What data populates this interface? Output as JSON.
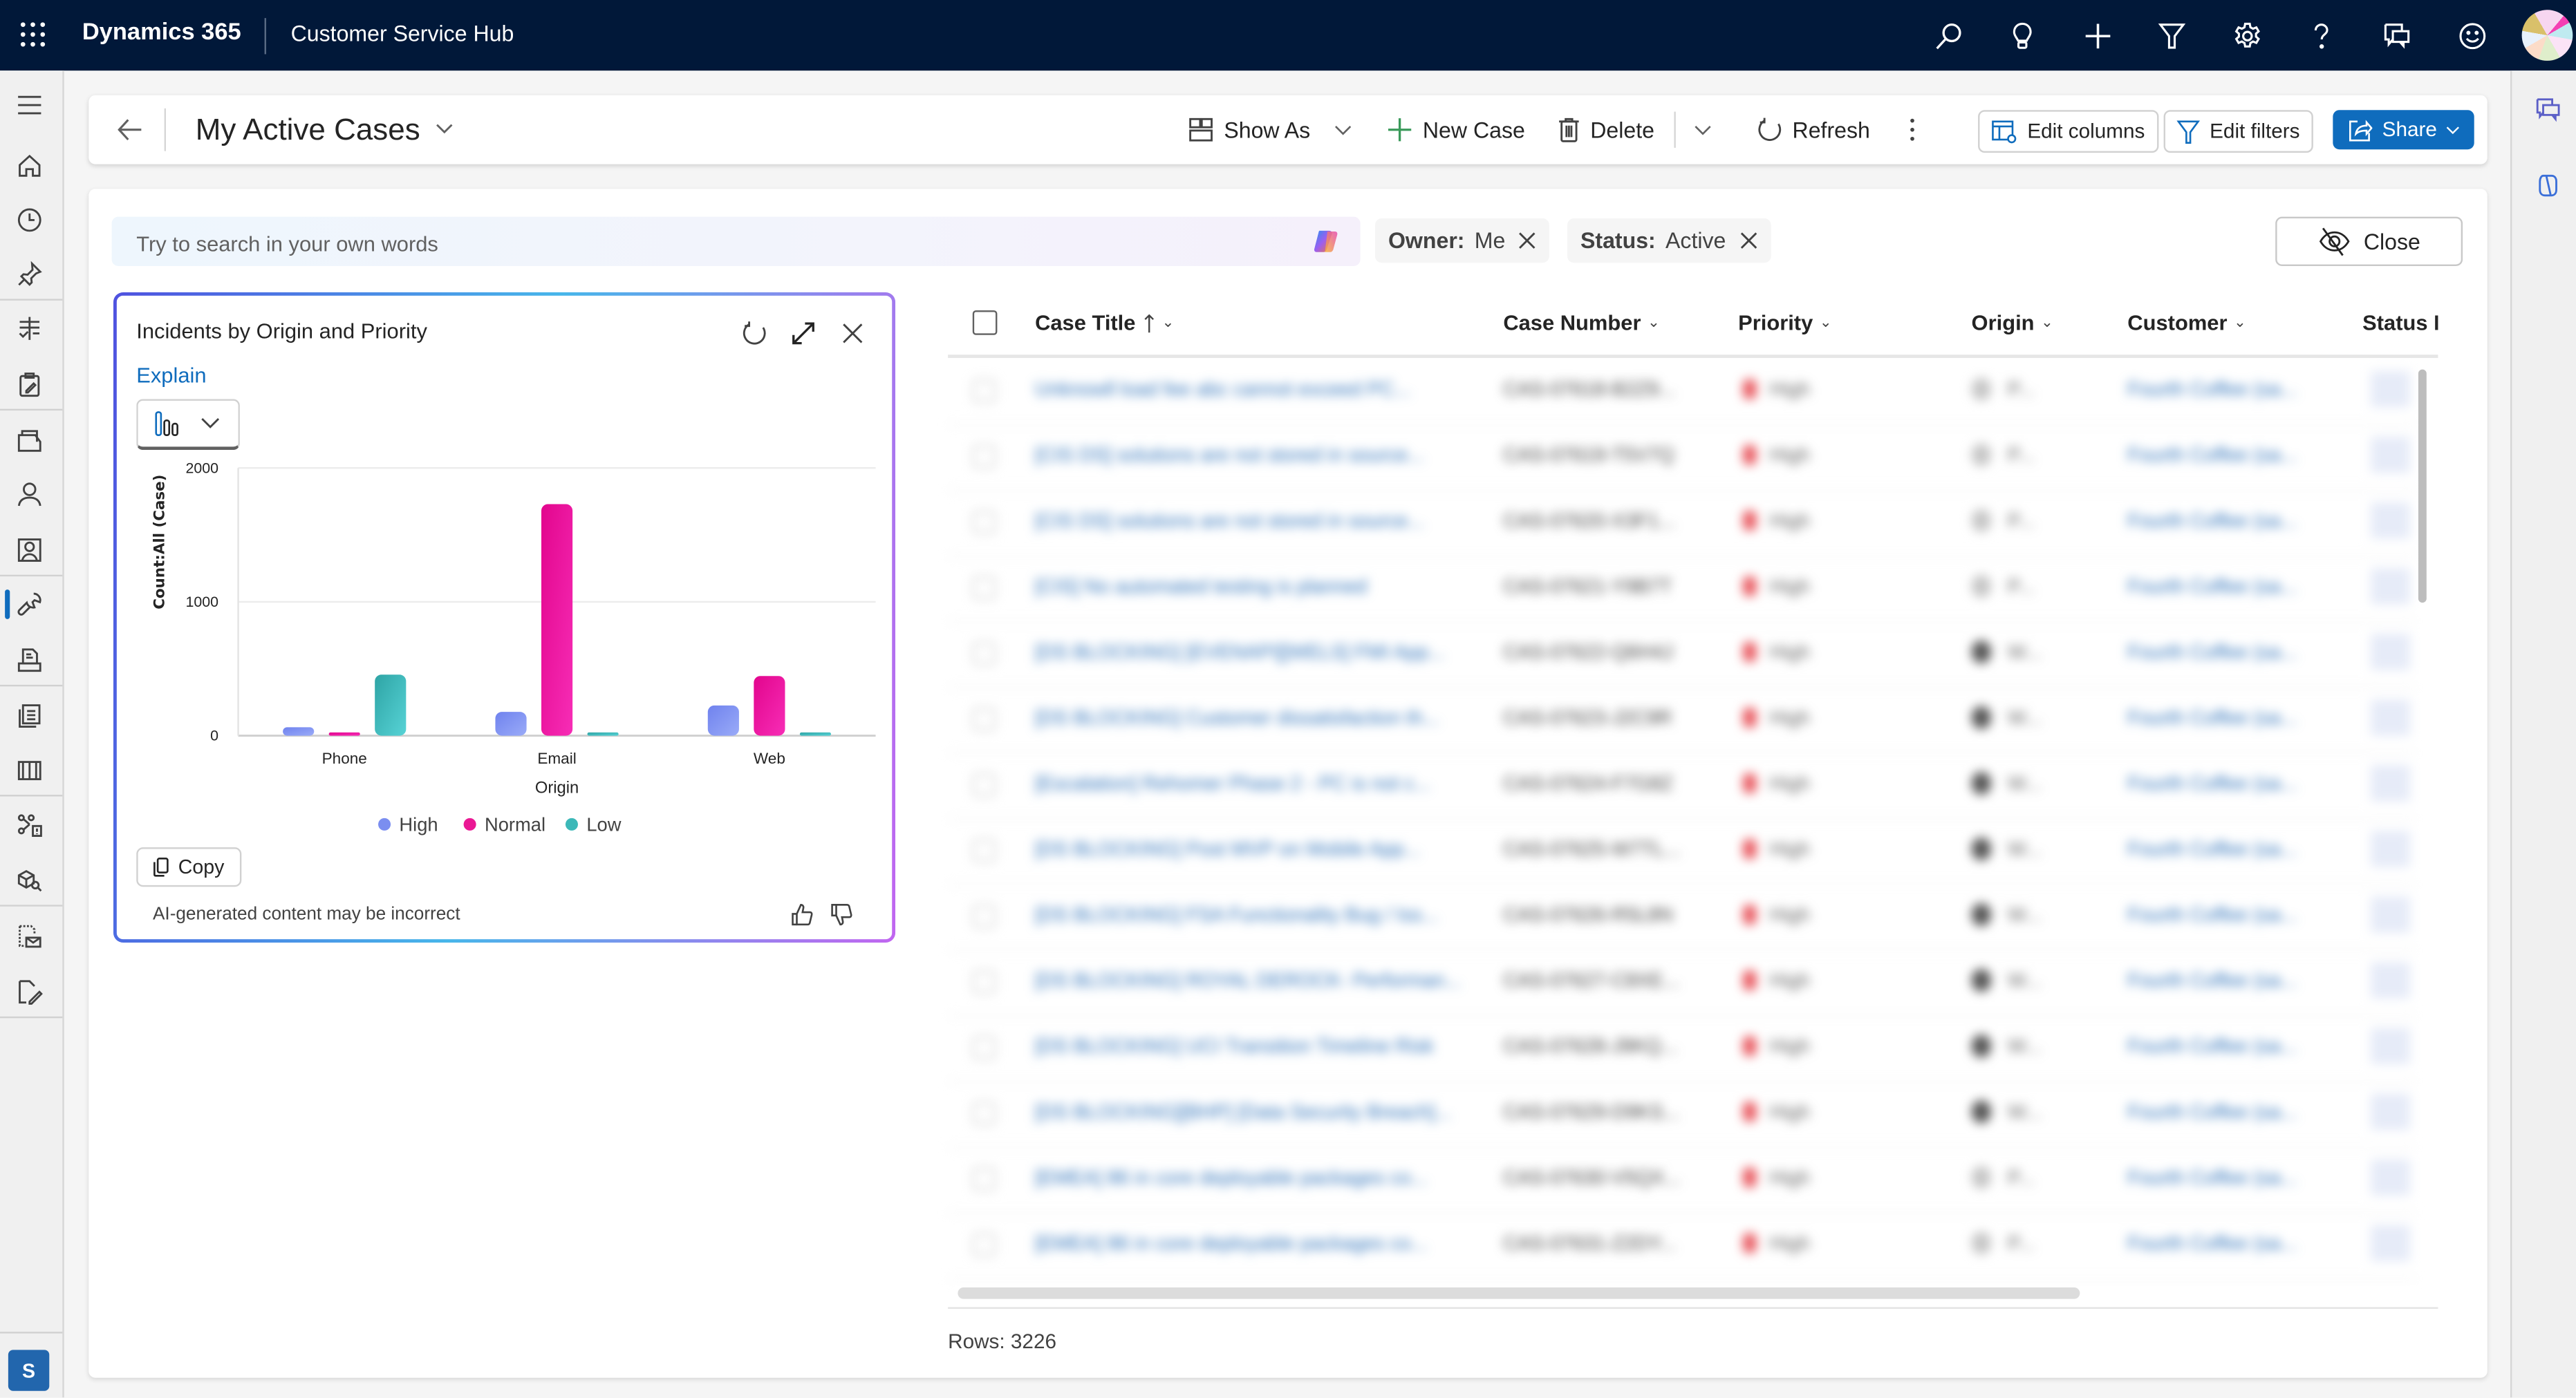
{
  "topbar": {
    "brand": "Dynamics 365",
    "app_name": "Customer Service Hub",
    "icons": [
      "search-icon",
      "lightbulb-icon",
      "plus-icon",
      "filter-icon",
      "settings-icon",
      "help-icon",
      "chat-icon",
      "feedback-smiley-icon",
      "user-avatar"
    ]
  },
  "leftnav": {
    "items": [
      {
        "name": "menu",
        "icon": "hamburger-icon"
      },
      {
        "name": "home",
        "icon": "home-icon"
      },
      {
        "name": "recent",
        "icon": "clock-icon"
      },
      {
        "name": "pinned",
        "icon": "pin-icon"
      },
      {
        "name": "dashboards",
        "icon": "dashboard-icon"
      },
      {
        "name": "activities",
        "icon": "clipboard-icon"
      },
      {
        "name": "accounts",
        "icon": "folder-icon"
      },
      {
        "name": "contacts",
        "icon": "person-icon"
      },
      {
        "name": "social-profiles",
        "icon": "contact-card-icon"
      },
      {
        "name": "cases",
        "icon": "wrench-icon",
        "active": true
      },
      {
        "name": "queues",
        "icon": "inbox-icon"
      },
      {
        "name": "knowledge-articles",
        "icon": "documents-icon"
      },
      {
        "name": "knowledge-search",
        "icon": "book-icon"
      },
      {
        "name": "entitlements",
        "icon": "network-icon"
      },
      {
        "name": "products",
        "icon": "box-key-icon"
      },
      {
        "name": "mail-templates",
        "icon": "mail-template-icon"
      },
      {
        "name": "notes",
        "icon": "page-edit-icon"
      }
    ],
    "area_switcher": "S"
  },
  "commandbar": {
    "view_title": "My Active Cases",
    "show_as": "Show As",
    "new_case": "New Case",
    "delete": "Delete",
    "refresh": "Refresh",
    "edit_columns": "Edit columns",
    "edit_filters": "Edit filters",
    "share": "Share"
  },
  "search": {
    "placeholder": "Try to search in your own words"
  },
  "filters": [
    {
      "label": "Owner:",
      "value": "Me"
    },
    {
      "label": "Status:",
      "value": "Active"
    }
  ],
  "close_button": "Close",
  "chart_card": {
    "title": "Incidents by Origin and Priority",
    "explain_link": "Explain",
    "copy_label": "Copy",
    "disclaimer": "AI-generated content may be incorrect",
    "colors": {
      "High": "#7b8ef0",
      "Normal": "#ea1894",
      "Low": "#3cb8b8"
    }
  },
  "chart_data": {
    "type": "bar",
    "title": "Incidents by Origin and Priority",
    "xlabel": "Origin",
    "ylabel": "Count:All (Case)",
    "categories": [
      "Phone",
      "Email",
      "Web"
    ],
    "series": [
      {
        "name": "High",
        "values": [
          63,
          178,
          226
        ]
      },
      {
        "name": "Normal",
        "values": [
          17,
          1730,
          446
        ]
      },
      {
        "name": "Low",
        "values": [
          456,
          17,
          17
        ]
      }
    ],
    "ylim": [
      0,
      2000
    ],
    "yticks": [
      0,
      1000,
      2000
    ],
    "grid": true,
    "legend": "bottom-center"
  },
  "grid": {
    "columns": [
      {
        "label": "Case Title",
        "sort": "ascending"
      },
      {
        "label": "Case Number"
      },
      {
        "label": "Priority"
      },
      {
        "label": "Origin"
      },
      {
        "label": "Customer"
      },
      {
        "label": "Status R"
      }
    ],
    "rows": [
      {
        "title": "Unknowll load fee abc cannot exceed PC...",
        "number": "CAS-07618-B2Z9...",
        "priority": "High",
        "origin": "P...",
        "origin_kind": "phone",
        "customer": "Fourth Coffee (sa..."
      },
      {
        "title": "[CIS DS] solutions are not stored in source...",
        "number": "CAS-07619-T5V7Q",
        "priority": "High",
        "origin": "P...",
        "origin_kind": "phone",
        "customer": "Fourth Coffee (sa..."
      },
      {
        "title": "[CIS DS] solutions are not stored in source...",
        "number": "CAS-07620-X3F1...",
        "priority": "High",
        "origin": "P...",
        "origin_kind": "phone",
        "customer": "Fourth Coffee (sa..."
      },
      {
        "title": "[CIS] No automated testing is planned",
        "number": "CAS-07621-Y9B7T",
        "priority": "High",
        "origin": "P...",
        "origin_kind": "phone",
        "customer": "Fourth Coffee (sa..."
      },
      {
        "title": "[DS BLOCKING] [EVENAPI][WELS] FMI App...",
        "number": "CAS-07622-Q6H4J",
        "priority": "High",
        "origin": "W...",
        "origin_kind": "web",
        "customer": "Fourth Coffee (sa..."
      },
      {
        "title": "[DS BLOCKING] Customer dissatisfaction th...",
        "number": "CAS-07623-J2C9R",
        "priority": "High",
        "origin": "W...",
        "origin_kind": "web",
        "customer": "Fourth Coffee (sa..."
      },
      {
        "title": "[Escalation] Rehomer Phase 2 - PC is not c...",
        "number": "CAS-07624-F7G8Z",
        "priority": "High",
        "origin": "W...",
        "origin_kind": "web",
        "customer": "Fourth Coffee (sa..."
      },
      {
        "title": "[DS BLOCKING] Post MVP on Mobile App...",
        "number": "CAS-07625-W7TL...",
        "priority": "High",
        "origin": "W...",
        "origin_kind": "web",
        "customer": "Fourth Coffee (sa..."
      },
      {
        "title": "[DS BLOCKING] FSA Functionality Bug / Iss...",
        "number": "CAS-07626-R5L8N",
        "priority": "High",
        "origin": "W...",
        "origin_kind": "web",
        "customer": "Fourth Coffee (sa..."
      },
      {
        "title": "[DS BLOCKING] ROYAL DEROCK- Performan...",
        "number": "CAS-07627-C8XE...",
        "priority": "High",
        "origin": "W...",
        "origin_kind": "web",
        "customer": "Fourth Coffee (sa..."
      },
      {
        "title": "[DS BLOCKING] UCI Transition Timeline Risk",
        "number": "CAS-07628-J9KQ...",
        "priority": "High",
        "origin": "W...",
        "origin_kind": "web",
        "customer": "Fourth Coffee (sa..."
      },
      {
        "title": "[DS BLOCKING][BHP] [Data Security Breach]...",
        "number": "CAS-07629-D9KS...",
        "priority": "High",
        "origin": "W...",
        "origin_kind": "web",
        "customer": "Fourth Coffee (sa..."
      },
      {
        "title": "[EMEA] 86 in core deployable packages co...",
        "number": "CAS-07630-V5QX...",
        "priority": "High",
        "origin": "P...",
        "origin_kind": "phone",
        "customer": "Fourth Coffee (sa..."
      },
      {
        "title": "[EMEA] 86 in core deployable packages co...",
        "number": "CAS-07631-Z2DY...",
        "priority": "High",
        "origin": "P...",
        "origin_kind": "phone",
        "customer": "Fourth Coffee (sa..."
      }
    ],
    "row_count_label": "Rows: 3226"
  },
  "rightrail": {
    "icons": [
      "conversations-icon",
      "copilot-icon"
    ]
  }
}
